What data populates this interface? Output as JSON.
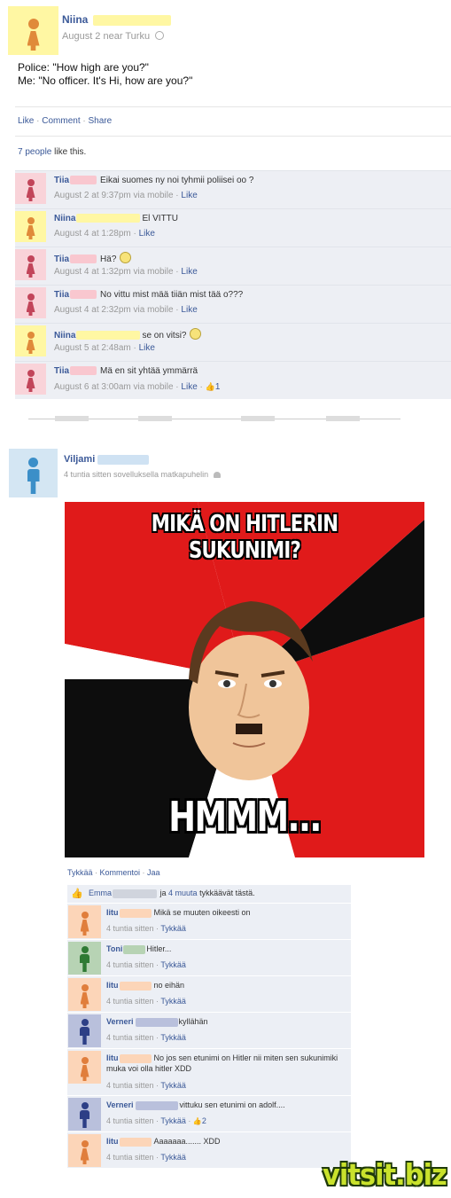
{
  "post1": {
    "author": "Niina",
    "date": "August 2 near Turku",
    "text_line1": "Police: \"How high are you?\"",
    "text_line2": "Me: \"No officer. It's Hi, how are you?\"",
    "actions": {
      "like": "Like",
      "sep1": " · ",
      "comment": "Comment",
      "sep2": " · ",
      "share": "Share"
    },
    "likes": {
      "count": "7 people",
      "suffix": " like this."
    },
    "comments": [
      {
        "name": "Tiia",
        "text": "Eikai suomes ny noi tyhmii poliisei oo ?",
        "time": "August 2 at 9:37pm via mobile",
        "sep": " · ",
        "like": "Like"
      },
      {
        "name": "Niina",
        "text": "El VITTU",
        "time": "August 4 at 1:28pm",
        "sep": " · ",
        "like": "Like"
      },
      {
        "name": "Tiia",
        "text": "Hä?",
        "time": "August 4 at 1:32pm via mobile",
        "sep": " · ",
        "like": "Like"
      },
      {
        "name": "Tiia",
        "text": "No vittu mist mää tiiän mist tää o???",
        "time": "August 4 at 2:32pm via mobile",
        "sep": " · ",
        "like": "Like"
      },
      {
        "name": "Niina",
        "text": "se on vitsi?",
        "time": "August 5 at 2:48am",
        "sep": " · ",
        "like": "Like"
      },
      {
        "name": "Tiia",
        "text": "Mä en sit yhtää ymmärrä",
        "time": "August 6 at 3:00am via mobile",
        "sep": " · ",
        "like": "Like",
        "sep2": " · ",
        "like_count": "1"
      }
    ]
  },
  "post2": {
    "author": "Viljami",
    "meta": "4 tuntia sitten sovelluksella matkapuhelin",
    "meme_top": "MIKÄ ON HITLERIN SUKUNIMI?",
    "meme_bottom": "HMMM...",
    "actions": {
      "like": "Tykkää",
      "sep1": " · ",
      "comment": "Kommentoi",
      "sep2": " · ",
      "share": "Jaa"
    },
    "likes": {
      "name": "Emma",
      "mid": " ja ",
      "others": "4 muuta",
      "suffix": " tykkäävät tästä."
    },
    "comments": [
      {
        "name": "Iitu",
        "text": "Mikä se muuten oikeesti on",
        "time": "4 tuntia sitten",
        "sep": " · ",
        "like": "Tykkää"
      },
      {
        "name": "Toni",
        "text": "Hitler...",
        "time": "4 tuntia sitten",
        "sep": " · ",
        "like": "Tykkää"
      },
      {
        "name": "Iitu",
        "text": "no eihän",
        "time": "4 tuntia sitten",
        "sep": " · ",
        "like": "Tykkää"
      },
      {
        "name": "Verneri",
        "text": "kyllähän",
        "time": "4 tuntia sitten",
        "sep": " · ",
        "like": "Tykkää"
      },
      {
        "name": "Iitu",
        "text": "No jos sen etunimi on Hitler nii miten sen sukunimiki muka voi olla hitler XDD",
        "time": "4 tuntia sitten",
        "sep": " · ",
        "like": "Tykkää"
      },
      {
        "name": "Verneri",
        "text": "vittuku sen etunimi on adolf....",
        "time": "4 tuntia sitten",
        "sep": " · ",
        "like": "Tykkää",
        "sep2": " · ",
        "like_count": "2"
      },
      {
        "name": "Iitu",
        "text": "Aaaaaaa....... XDD",
        "time": "4 tuntia sitten",
        "sep": " · ",
        "like": "Tykkää"
      }
    ]
  },
  "watermark": "vitsit.biz",
  "colors": {
    "link": "#3b5998",
    "female_red": "#c2455a",
    "female_orange": "#e07e3c",
    "female_yellow_bg": "#fffbb0",
    "male_blue": "#3c8fc8"
  }
}
